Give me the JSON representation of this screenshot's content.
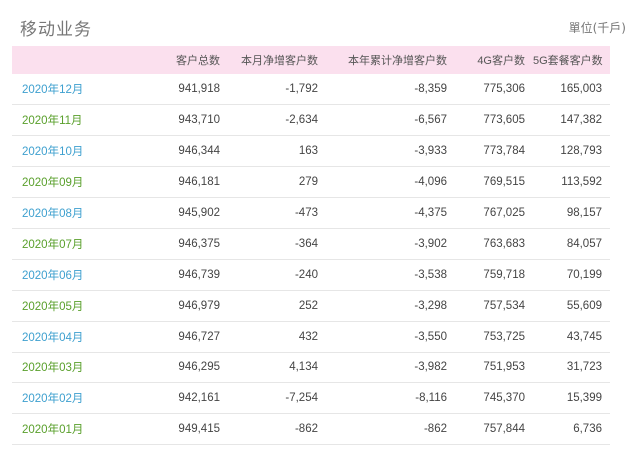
{
  "header": {
    "title": "移动业务",
    "unit": "單位(千戶)"
  },
  "table": {
    "columns": [
      "",
      "客户总数",
      "本月净增客户数",
      "本年累计净增客户数",
      "4G客户数",
      "5G套餐客户数"
    ],
    "rows": [
      [
        "2020年12月",
        "941,918",
        "-1,792",
        "-8,359",
        "775,306",
        "165,003"
      ],
      [
        "2020年11月",
        "943,710",
        "-2,634",
        "-6,567",
        "773,605",
        "147,382"
      ],
      [
        "2020年10月",
        "946,344",
        "163",
        "-3,933",
        "773,784",
        "128,793"
      ],
      [
        "2020年09月",
        "946,181",
        "279",
        "-4,096",
        "769,515",
        "113,592"
      ],
      [
        "2020年08月",
        "945,902",
        "-473",
        "-4,375",
        "767,025",
        "98,157"
      ],
      [
        "2020年07月",
        "946,375",
        "-364",
        "-3,902",
        "763,683",
        "84,057"
      ],
      [
        "2020年06月",
        "946,739",
        "-240",
        "-3,538",
        "759,718",
        "70,199"
      ],
      [
        "2020年05月",
        "946,979",
        "252",
        "-3,298",
        "757,534",
        "55,609"
      ],
      [
        "2020年04月",
        "946,727",
        "432",
        "-3,550",
        "753,725",
        "43,745"
      ],
      [
        "2020年03月",
        "946,295",
        "4,134",
        "-3,982",
        "751,953",
        "31,723"
      ],
      [
        "2020年02月",
        "942,161",
        "-7,254",
        "-8,116",
        "745,370",
        "15,399"
      ],
      [
        "2020年01月",
        "949,415",
        "-862",
        "-862",
        "757,844",
        "6,736"
      ]
    ]
  },
  "colors": {
    "header_bg": "#fbe0ee",
    "month_blue": "#3ea0cf",
    "month_green": "#5aa02c"
  }
}
